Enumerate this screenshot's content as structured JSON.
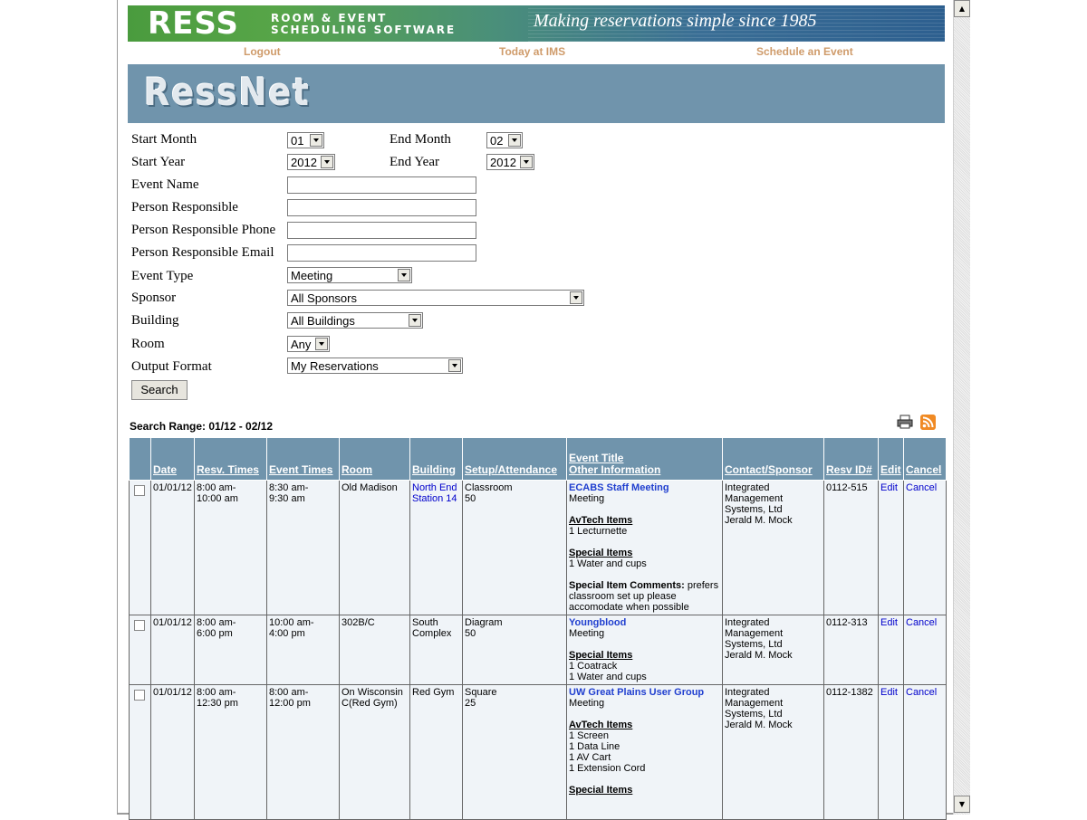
{
  "banner": {
    "logo_main": "RESS",
    "logo_sub1": "ROOM & EVENT",
    "logo_sub2": "SCHEDULING SOFTWARE",
    "tagline": "Making reservations simple since 1985"
  },
  "nav": {
    "logout": "Logout",
    "today": "Today at IMS",
    "schedule": "Schedule an Event"
  },
  "header": {
    "title": "RessNet"
  },
  "form": {
    "start_month_label": "Start Month",
    "start_month_value": "01",
    "end_month_label": "End Month",
    "end_month_value": "02",
    "start_year_label": "Start Year",
    "start_year_value": "2012",
    "end_year_label": "End Year",
    "end_year_value": "2012",
    "event_name_label": "Event Name",
    "person_label": "Person Responsible",
    "phone_label": "Person Responsible Phone",
    "email_label": "Person Responsible Email",
    "event_type_label": "Event Type",
    "event_type_value": "Meeting",
    "sponsor_label": "Sponsor",
    "sponsor_value": "All Sponsors",
    "building_label": "Building",
    "building_value": "All Buildings",
    "room_label": "Room",
    "room_value": "Any",
    "output_label": "Output Format",
    "output_value": "My Reservations",
    "search_button": "Search"
  },
  "results": {
    "range_text": "Search Range: 01/12 - 02/12",
    "columns": {
      "date": "Date",
      "resv_times": "Resv. Times",
      "event_times": "Event Times",
      "room": "Room",
      "building": "Building",
      "setup": "Setup/Attendance",
      "title1": "Event Title",
      "title2": "Other Information",
      "contact": "Contact/Sponsor",
      "resv_id": "Resv ID#",
      "edit": "Edit",
      "cancel": "Cancel"
    },
    "rows": [
      {
        "date": "01/01/12",
        "resv1": "8:00 am-",
        "resv2": "10:00 am",
        "evt1": "8:30 am-",
        "evt2": "9:30 am",
        "room": "Old Madison",
        "building1": "North End",
        "building2": "Station 14",
        "setup1": "Classroom",
        "setup2": "50",
        "title": "ECABS Staff Meeting",
        "type": "Meeting",
        "av_label": "AvTech Items",
        "av1": "1 Lecturnette",
        "special_label": "Special Items",
        "sp1": "1 Water and cups",
        "comment_label": "Special Item Comments:",
        "comment_text": "prefers classroom set up please accomodate when possible",
        "contact1": "Integrated",
        "contact2": "Management",
        "contact3": "Systems, Ltd",
        "contact4": "Jerald M. Mock",
        "id": "0112-515",
        "edit": "Edit",
        "cancel": "Cancel"
      },
      {
        "date": "01/01/12",
        "resv1": "8:00 am-",
        "resv2": "6:00 pm",
        "evt1": "10:00 am-",
        "evt2": "4:00 pm",
        "room": "302B/C",
        "building1": "South",
        "building2": "Complex",
        "setup1": "Diagram",
        "setup2": "50",
        "title": "Youngblood",
        "type": "Meeting",
        "special_label": "Special Items",
        "sp1": "1 Coatrack",
        "sp2": "1 Water and cups",
        "contact1": "Integrated",
        "contact2": "Management",
        "contact3": "Systems, Ltd",
        "contact4": "Jerald M. Mock",
        "id": "0112-313",
        "edit": "Edit",
        "cancel": "Cancel"
      },
      {
        "date": "01/01/12",
        "resv1": "8:00 am-",
        "resv2": "12:30 pm",
        "evt1": "8:00 am-",
        "evt2": "12:00 pm",
        "room1": "On Wisconsin",
        "room2": "C(Red Gym)",
        "building": "Red Gym",
        "setup1": "Square",
        "setup2": "25",
        "title": "UW Great Plains User Group",
        "type": "Meeting",
        "av_label": "AvTech Items",
        "av1": "1 Screen",
        "av2": "1 Data Line",
        "av3": "1 AV Cart",
        "av4": "1 Extension Cord",
        "special_label": "Special Items",
        "contact1": "Integrated",
        "contact2": "Management",
        "contact3": "Systems, Ltd",
        "contact4": "Jerald M. Mock",
        "id": "0112-1382",
        "edit": "Edit",
        "cancel": "Cancel"
      }
    ]
  },
  "colors": {
    "header_blue": "#7094ac",
    "nav_orange": "#cf9b6a",
    "link_blue": "#0000cc",
    "row_bg": "#f0f4f8"
  }
}
